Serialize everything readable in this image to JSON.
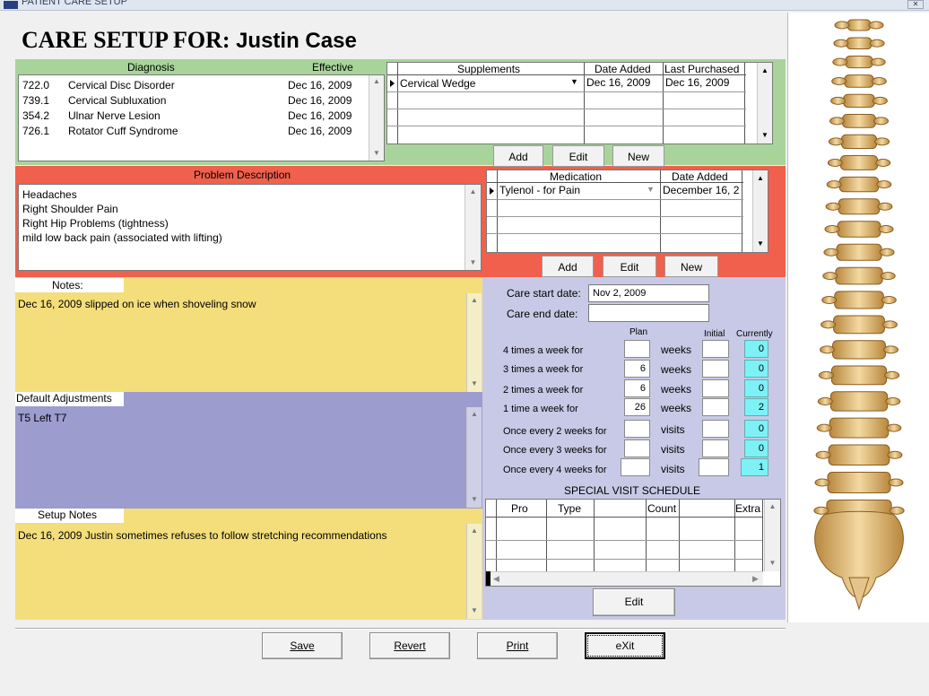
{
  "window": {
    "title": "PATIENT CARE SETUP",
    "close_label": "✕"
  },
  "heading": {
    "prefix": "CARE SETUP FOR:",
    "patient": "Justin Case"
  },
  "diagnosis": {
    "headers": {
      "name": "Diagnosis",
      "effective": "Effective"
    },
    "rows": [
      {
        "code": "722.0",
        "name": "Cervical Disc Disorder",
        "date": "Dec 16, 2009"
      },
      {
        "code": "739.1",
        "name": "Cervical Subluxation",
        "date": "Dec 16, 2009"
      },
      {
        "code": "354.2",
        "name": "Ulnar Nerve Lesion",
        "date": "Dec 16, 2009"
      },
      {
        "code": "726.1",
        "name": "Rotator Cuff Syndrome",
        "date": "Dec 16, 2009"
      }
    ]
  },
  "supplements": {
    "headers": {
      "name": "Supplements",
      "date_added": "Date Added",
      "last_purchased": "Last Purchased"
    },
    "rows": [
      {
        "name": "Cervical Wedge",
        "date_added": "Dec 16, 2009",
        "last_purchased": "Dec 16, 2009"
      }
    ],
    "buttons": {
      "add": "Add",
      "edit": "Edit",
      "new": "New"
    }
  },
  "problem": {
    "header": "Problem Description",
    "lines": [
      "Headaches",
      "Right Shoulder Pain",
      "Right Hip Problems (tightness)",
      "mild low back pain (associated with lifting)"
    ]
  },
  "medication": {
    "headers": {
      "name": "Medication",
      "date_added": "Date Added"
    },
    "rows": [
      {
        "name": "Tylenol - for Pain",
        "date_added": "December 16, 2"
      }
    ],
    "buttons": {
      "add": "Add",
      "edit": "Edit",
      "new": "New"
    }
  },
  "notes": {
    "label": "Notes:",
    "text": "Dec 16, 2009 slipped on ice when shoveling snow"
  },
  "adjustments": {
    "label": "Default Adjustments",
    "text": "T5 Left T7"
  },
  "setup_notes": {
    "label": "Setup Notes",
    "text": "Dec 16, 2009 Justin sometimes refuses to follow stretching recommendations"
  },
  "care": {
    "start_label": "Care start date:",
    "start_value": "Nov  2, 2009",
    "end_label": "Care end date:",
    "end_value": "",
    "col_plan": "Plan",
    "col_initial": "Initial",
    "col_currently": "Currently",
    "rows": [
      {
        "label": "4 times a week for",
        "plan": "",
        "unit": "weeks",
        "initial": "",
        "current": "0"
      },
      {
        "label": "3 times a week for",
        "plan": "6",
        "unit": "weeks",
        "initial": "",
        "current": "0"
      },
      {
        "label": "2 times a week for",
        "plan": "6",
        "unit": "weeks",
        "initial": "",
        "current": "0"
      },
      {
        "label": "1 time a week for",
        "plan": "26",
        "unit": "weeks",
        "initial": "",
        "current": "2"
      },
      {
        "label": "Once every 2 weeks for",
        "plan": "",
        "unit": "visits",
        "initial": "",
        "current": "0"
      },
      {
        "label": "Once every 3 weeks for",
        "plan": "",
        "unit": "visits",
        "initial": "",
        "current": "0"
      },
      {
        "label": "Once every 4 weeks for",
        "plan": "",
        "unit": "visits",
        "initial": "",
        "current": "1"
      }
    ]
  },
  "special": {
    "title": "SPECIAL VISIT SCHEDULE",
    "headers": {
      "pro": "Pro",
      "type": "Type",
      "count": "Count",
      "extra": "Extra"
    },
    "edit_label": "Edit"
  },
  "footer": {
    "save": "Save",
    "revert": "Revert",
    "print": "Print",
    "exit": "eXit"
  },
  "colors": {
    "green": "#a8d49b",
    "red": "#f0604c",
    "lavender": "#c8c9e6",
    "yellow": "#f4de7b",
    "purple": "#9c9ccf",
    "cyan": "#7cf2f6"
  },
  "icons": {
    "spine": "spine-image",
    "row-pointer": "row-pointer-icon",
    "dropdown": "dropdown-arrow-icon"
  }
}
